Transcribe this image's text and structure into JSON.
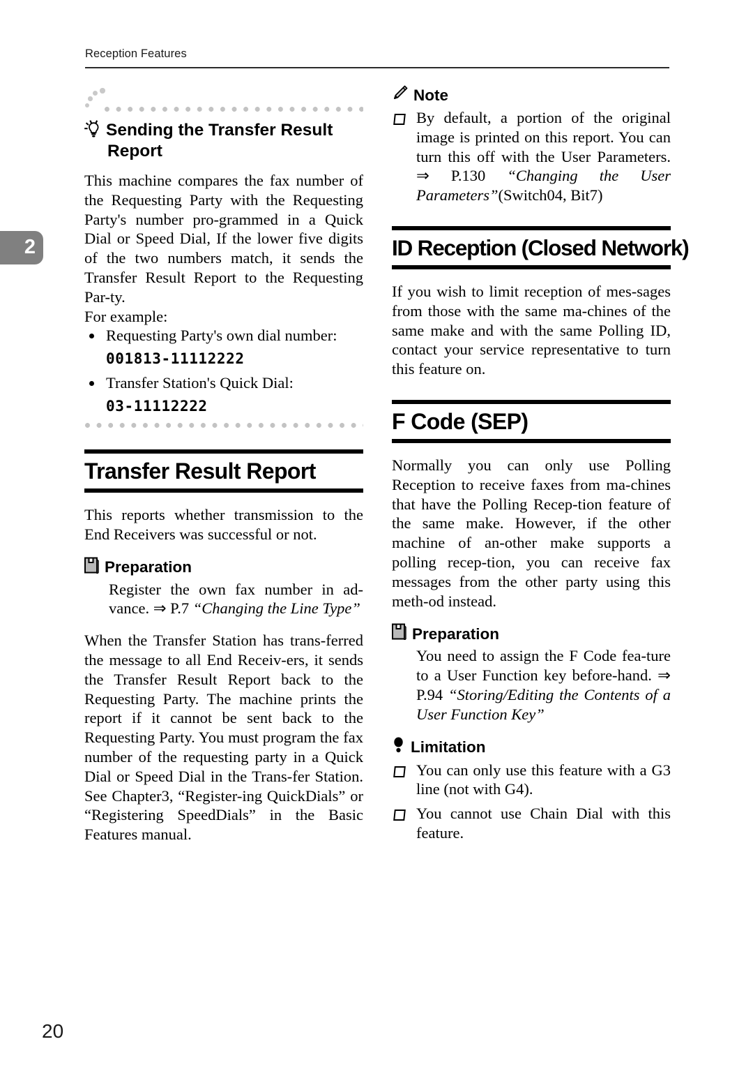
{
  "header": {
    "running_head": "Reception Features"
  },
  "chapter_tab": {
    "number": "2"
  },
  "page_number": "20",
  "left_column": {
    "tip": {
      "icon": "lightbulb-icon",
      "title": "Sending the Transfer Result Report",
      "paragraph": "This machine compares the fax number of the Requesting Party with the Requesting Party's number pro-grammed in a Quick Dial or Speed Dial, If the lower five digits of the two numbers match, it sends the Transfer Result Report to the Requesting Par-ty.",
      "example_intro": "For example:",
      "items": [
        {
          "label": "Requesting Party's own dial number:",
          "value": "001813-11112222"
        },
        {
          "label": "Transfer Station's Quick Dial:",
          "value": "03-11112222"
        }
      ]
    },
    "section": {
      "title": "Transfer Result Report",
      "intro": "This reports whether transmission to the End Receivers was successful or not.",
      "preparation": {
        "icon": "book-icon",
        "label": "Preparation",
        "text_plain": "Register the own fax number in ad-vance. ⇒ P.7 ",
        "text_italic": "“Changing the Line Type”"
      },
      "body": "When the Transfer Station has trans-ferred the message to all End Receiv-ers, it sends the Transfer Result Report back to the Requesting Party. The machine prints the report if it cannot be sent back to the Requesting Party. You must program the fax number of the requesting party in a Quick Dial or Speed Dial in the Trans-fer Station. See Chapter3, “Register-ing QuickDials” or “Registering SpeedDials” in the Basic Features manual."
    }
  },
  "right_column": {
    "note": {
      "icon": "pencil-icon",
      "label": "Note",
      "items": [
        {
          "text_plain_1": "By default, a portion of the original image is printed on this report. You can turn this off with the User Parameters. ⇒ P.130 ",
          "text_italic": "“Changing the User Parameters”",
          "text_plain_2": "(Switch04, Bit7)"
        }
      ]
    },
    "section_id_reception": {
      "title": "ID Reception (Closed Network)",
      "body": "If you wish to limit reception of mes-sages from those with the same ma-chines of the same make and with the same Polling ID, contact your service representative to turn this feature on."
    },
    "section_f_code": {
      "title": "F Code (SEP)",
      "body": "Normally you can only use Polling Reception to receive faxes from ma-chines that have the Polling Recep-tion feature of the same make. However, if the other machine of an-other make supports a polling recep-tion, you can receive fax messages from the other party using this meth-od instead.",
      "preparation": {
        "icon": "book-icon",
        "label": "Preparation",
        "text_plain": "You need to assign the F Code fea-ture to a User Function key before-hand. ⇒ P.94 ",
        "text_italic": "“Storing/Editing the Contents of a User Function Key”"
      },
      "limitation": {
        "icon": "exclamation-icon",
        "label": "Limitation",
        "items": [
          "You can only use this feature with a G3 line (not with G4).",
          "You cannot use Chain Dial with this feature."
        ]
      }
    }
  }
}
